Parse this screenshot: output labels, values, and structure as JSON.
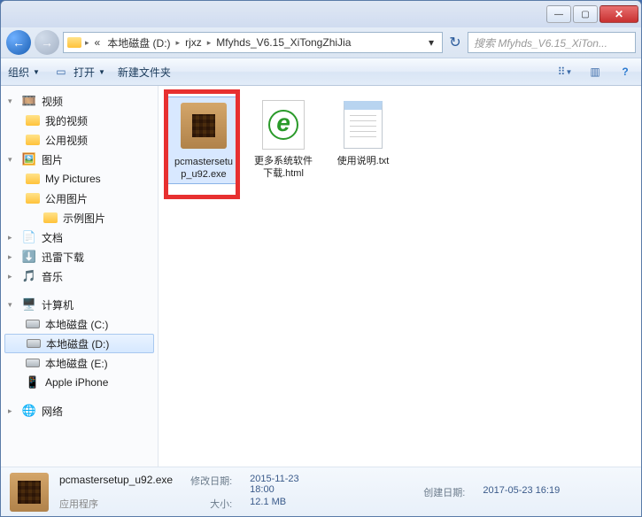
{
  "address": {
    "crumbs": [
      "本地磁盘 (D:)",
      "rjxz",
      "Mfyhds_V6.15_XiTongZhiJia"
    ]
  },
  "search": {
    "placeholder": "搜索 Mfyhds_V6.15_XiTon..."
  },
  "toolbar": {
    "organize": "组织",
    "open": "打开",
    "newfolder": "新建文件夹"
  },
  "sidebar": {
    "video": "视频",
    "myvideo": "我的视频",
    "publicvideo": "公用视频",
    "pictures": "图片",
    "mypictures": "My Pictures",
    "publicpictures": "公用图片",
    "samplepictures": "示例图片",
    "documents": "文档",
    "xunlei": "迅雷下载",
    "music": "音乐",
    "computer": "计算机",
    "driveC": "本地磁盘 (C:)",
    "driveD": "本地磁盘 (D:)",
    "driveE": "本地磁盘 (E:)",
    "iphone": "Apple iPhone",
    "network": "网络"
  },
  "files": {
    "f1": "pcmastersetup_u92.exe",
    "f2": "更多系统软件下载.html",
    "f3": "使用说明.txt"
  },
  "details": {
    "filename": "pcmastersetup_u92.exe",
    "filetype": "应用程序",
    "modlabel": "修改日期:",
    "modval": "2015-11-23 18:00",
    "sizelabel": "大小:",
    "sizeval": "12.1 MB",
    "createlabel": "创建日期:",
    "createval": "2017-05-23 16:19"
  }
}
